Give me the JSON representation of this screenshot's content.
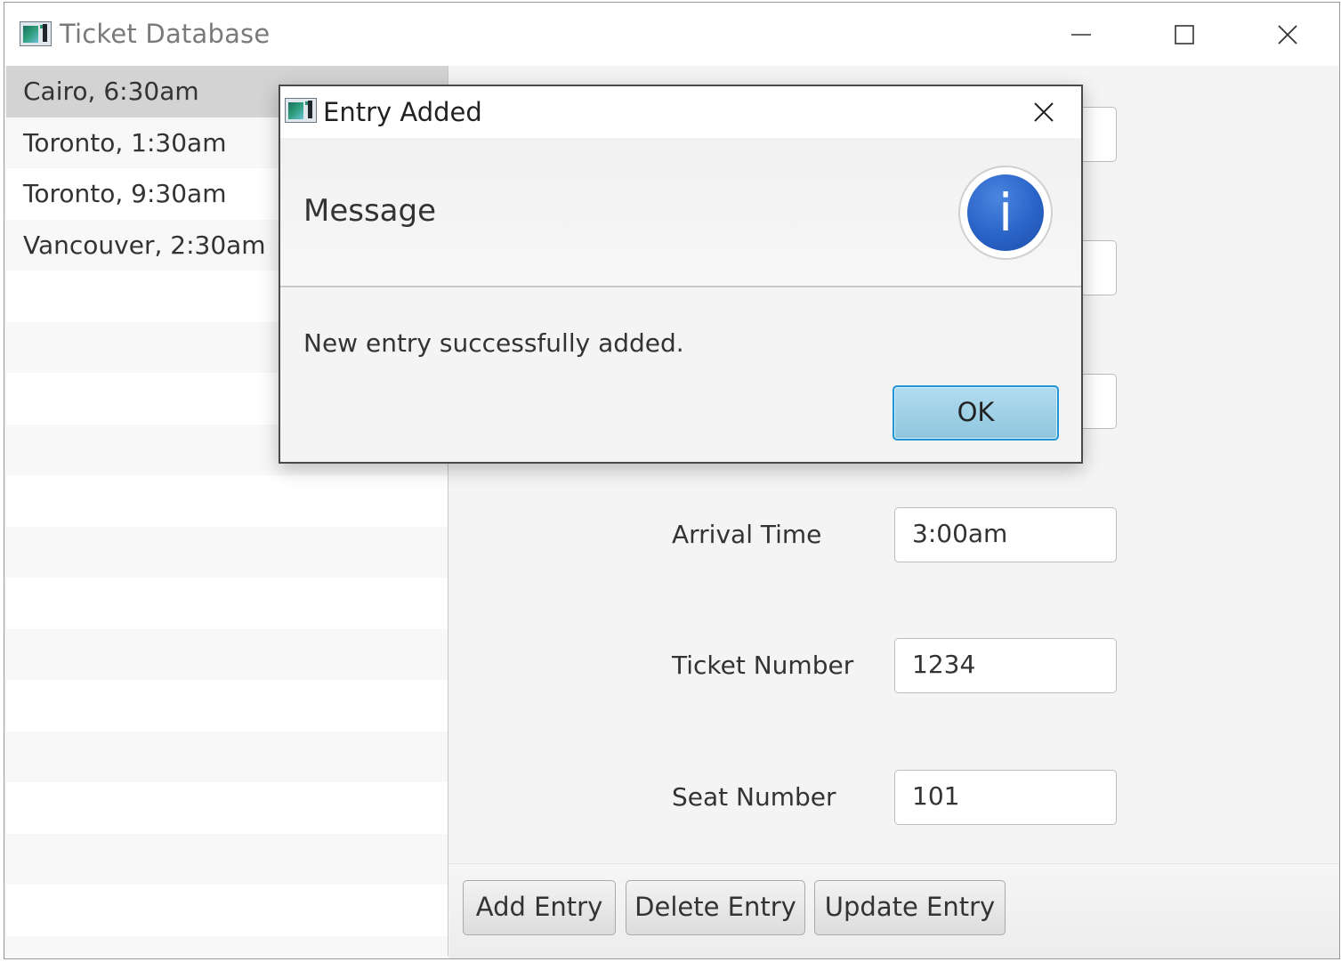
{
  "window": {
    "title": "Ticket Database",
    "icon": "app-icon",
    "controls": {
      "minimize": "minimize-icon",
      "maximize": "maximize-icon",
      "close": "close-icon"
    }
  },
  "list": {
    "items": [
      {
        "label": "Cairo, 6:30am",
        "selected": true
      },
      {
        "label": "Toronto, 1:30am"
      },
      {
        "label": "Toronto, 9:30am"
      },
      {
        "label": "Vancouver, 2:30am"
      }
    ]
  },
  "form": {
    "arrival_time": {
      "label": "Arrival Time",
      "value": "3:00am"
    },
    "ticket_number": {
      "label": "Ticket Number",
      "value": "1234"
    },
    "seat_number": {
      "label": "Seat Number",
      "value": "101"
    }
  },
  "buttons": {
    "add": "Add Entry",
    "delete": "Delete Entry",
    "update": "Update Entry"
  },
  "dialog": {
    "title": "Entry Added",
    "header": "Message",
    "icon": "info-icon",
    "info_glyph": "i",
    "content": "New entry successfully added.",
    "ok_label": "OK",
    "accent": "#2a63c7"
  }
}
